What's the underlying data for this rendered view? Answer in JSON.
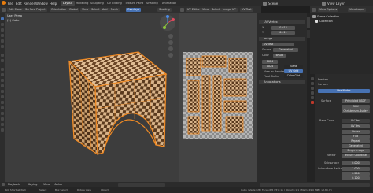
{
  "menubar": {
    "menus": [
      "File",
      "Edit",
      "Render",
      "Window",
      "Help"
    ],
    "tabs": [
      "Layout",
      "Modeling",
      "Sculpting",
      "UV Editing",
      "Texture Paint",
      "Shading",
      "Animation"
    ],
    "scene": "Scene",
    "view_layer": "View Layer"
  },
  "viewport_header": {
    "mode": "Edit Mode",
    "object": "Surface Project",
    "orientation": "Orientation",
    "global": "Global",
    "view": "View",
    "select": "Select",
    "add": "Add",
    "mesh": "Mesh",
    "overlays": "Overlays",
    "shading": "Shading"
  },
  "viewport_info": [
    "User Persp",
    "(1) Cube"
  ],
  "uv_header": {
    "editor": "UV Editor",
    "view": "View",
    "select": "Select",
    "image": "Image",
    "uv": "UV",
    "image_name": "UV Test"
  },
  "image_panel": {
    "tab_image": "Image",
    "tab_uv_vertex": "UV Vertex",
    "x_label": "X",
    "x_value": "0.613",
    "y_label": "Y",
    "y_value": "0.411",
    "image_title": "Image",
    "image_name": "UV Test",
    "source_label": "Source",
    "source_value": "Generated",
    "color_label": "Color",
    "color_value": "sRGB",
    "x_res": "1024",
    "y_res": "1024",
    "float_buffer": "Float Buffer",
    "blank": "Blank",
    "uv_grid": "UV Grid",
    "color_grid": "Color Grid",
    "view_as_render": "View as Render",
    "annotations": "Annotations"
  },
  "outliner": {
    "title": "Scene Collection",
    "collection": "Collection",
    "view_options": "View Options",
    "view_layer": "View Layer"
  },
  "properties": {
    "object": "Cube",
    "material": "Material",
    "preview": "Preview",
    "surface_section": "Surface",
    "use_nodes": "Use Nodes",
    "surface_label": "Surface",
    "surface_value": "Principled BSDF",
    "ggx": "GGX",
    "christensen": "Christensen-Burley",
    "base_color": "Base Color",
    "uv_test": "UV Test",
    "linear": "Linear",
    "flat": "Flat",
    "repeat": "Repeat",
    "generated": "Generated",
    "single_image": "Single Image",
    "vector": "Vector",
    "vector_value": "Texture Coordinat",
    "subsurface_label": "Subsurface",
    "subsurface_value": "0.000",
    "subsurface_radius_label": "Subsurface Radius",
    "subsurface_radius_value": "1.000",
    "v1": "0.200",
    "v2": "0.100"
  },
  "statusbar": {
    "left": [
      "Pick Shortest Path",
      "Select",
      "Box Select",
      "Rotate View",
      "Object"
    ],
    "right": "Cube | Verts:8/8 | Faces:6/6 | Tris:12 | Objects:1/1 | Mem: 29.0 MiB | v2.80.74"
  },
  "bottom_bar": {
    "playback": "Playback",
    "keying": "Keying",
    "view": "View",
    "marker": "Marker"
  },
  "colors": {
    "checker_dark": "#5a3a1e",
    "checker_light": "#d9b48a",
    "edge": "#f08a24",
    "accent": "#4772b3"
  }
}
